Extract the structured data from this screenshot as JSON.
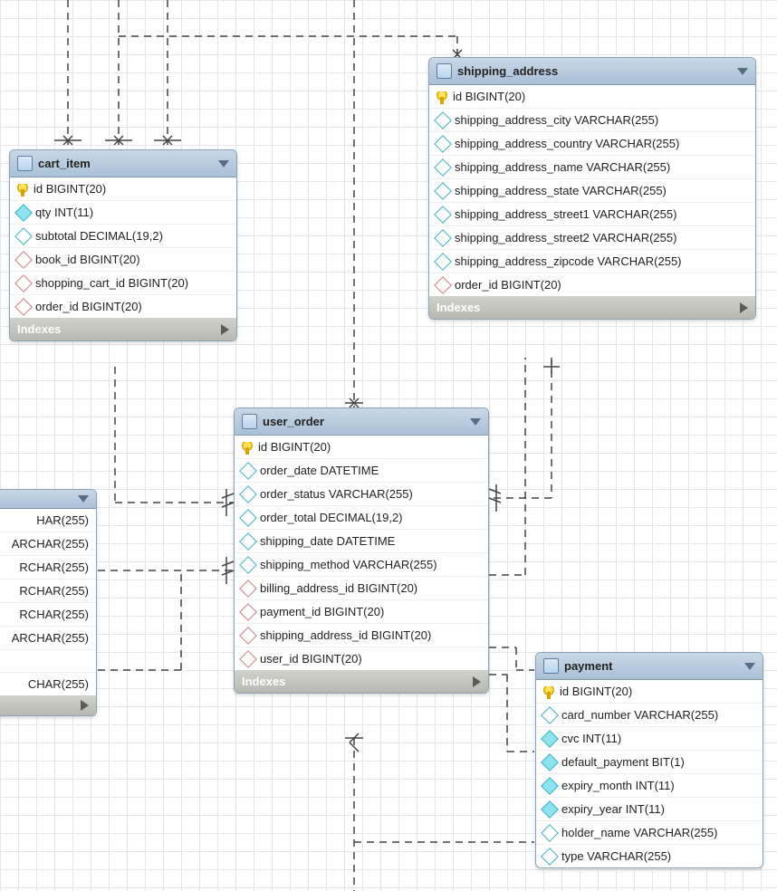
{
  "tables": {
    "cart_item": {
      "title": "cart_item",
      "columns": [
        {
          "icon": "key",
          "label": "id BIGINT(20)"
        },
        {
          "icon": "diam",
          "label": "qty INT(11)"
        },
        {
          "icon": "hollow",
          "label": "subtotal DECIMAL(19,2)"
        },
        {
          "icon": "pink",
          "label": "book_id BIGINT(20)"
        },
        {
          "icon": "pink",
          "label": "shopping_cart_id BIGINT(20)"
        },
        {
          "icon": "pink",
          "label": "order_id BIGINT(20)"
        }
      ],
      "indexes": "Indexes"
    },
    "shipping_address": {
      "title": "shipping_address",
      "columns": [
        {
          "icon": "key",
          "label": "id BIGINT(20)"
        },
        {
          "icon": "hollow",
          "label": "shipping_address_city VARCHAR(255)"
        },
        {
          "icon": "hollow",
          "label": "shipping_address_country VARCHAR(255)"
        },
        {
          "icon": "hollow",
          "label": "shipping_address_name VARCHAR(255)"
        },
        {
          "icon": "hollow",
          "label": "shipping_address_state VARCHAR(255)"
        },
        {
          "icon": "hollow",
          "label": "shipping_address_street1 VARCHAR(255)"
        },
        {
          "icon": "hollow",
          "label": "shipping_address_street2 VARCHAR(255)"
        },
        {
          "icon": "hollow",
          "label": "shipping_address_zipcode VARCHAR(255)"
        },
        {
          "icon": "pink",
          "label": "order_id BIGINT(20)"
        }
      ],
      "indexes": "Indexes"
    },
    "user_order": {
      "title": "user_order",
      "columns": [
        {
          "icon": "key",
          "label": "id BIGINT(20)"
        },
        {
          "icon": "hollow",
          "label": "order_date DATETIME"
        },
        {
          "icon": "hollow",
          "label": "order_status VARCHAR(255)"
        },
        {
          "icon": "hollow",
          "label": "order_total DECIMAL(19,2)"
        },
        {
          "icon": "hollow",
          "label": "shipping_date DATETIME"
        },
        {
          "icon": "hollow",
          "label": "shipping_method VARCHAR(255)"
        },
        {
          "icon": "pink",
          "label": "billing_address_id BIGINT(20)"
        },
        {
          "icon": "pink",
          "label": "payment_id BIGINT(20)"
        },
        {
          "icon": "pink",
          "label": "shipping_address_id BIGINT(20)"
        },
        {
          "icon": "pink",
          "label": "user_id BIGINT(20)"
        }
      ],
      "indexes": "Indexes"
    },
    "payment": {
      "title": "payment",
      "columns": [
        {
          "icon": "key",
          "label": "id BIGINT(20)"
        },
        {
          "icon": "hollow",
          "label": "card_number VARCHAR(255)"
        },
        {
          "icon": "diam",
          "label": "cvc INT(11)"
        },
        {
          "icon": "diam",
          "label": "default_payment BIT(1)"
        },
        {
          "icon": "diam",
          "label": "expiry_month INT(11)"
        },
        {
          "icon": "diam",
          "label": "expiry_year INT(11)"
        },
        {
          "icon": "hollow",
          "label": "holder_name VARCHAR(255)"
        },
        {
          "icon": "hollow",
          "label": "type VARCHAR(255)"
        }
      ]
    },
    "partial_left": {
      "columns": [
        {
          "label": "HAR(255)"
        },
        {
          "label": "ARCHAR(255)"
        },
        {
          "label": "RCHAR(255)"
        },
        {
          "label": "RCHAR(255)"
        },
        {
          "label": "RCHAR(255)"
        },
        {
          "label": "ARCHAR(255)"
        },
        {
          "label": ""
        },
        {
          "label": "CHAR(255)"
        }
      ],
      "indexes": ""
    }
  }
}
